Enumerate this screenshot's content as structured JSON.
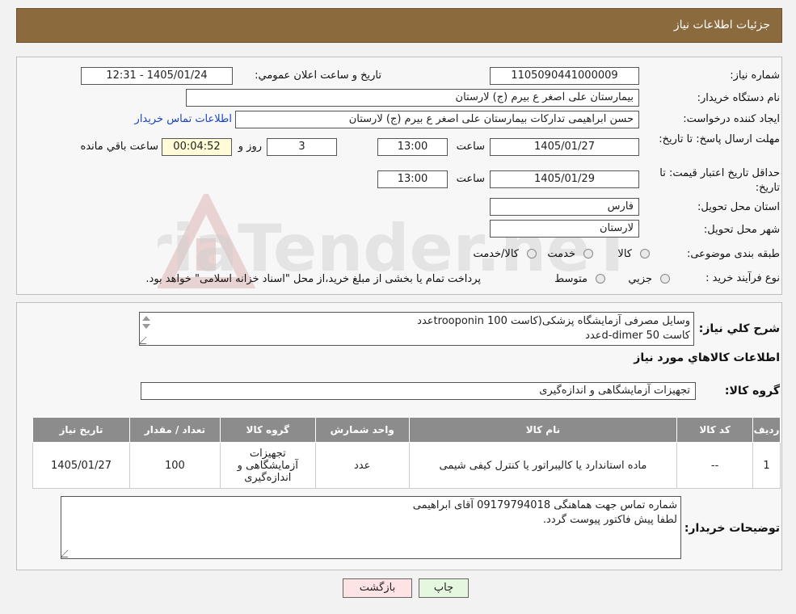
{
  "header": {
    "title": "جزئیات اطلاعات نیاز"
  },
  "need": {
    "number_label": "شماره نیاز:",
    "number_value": "1105090441000009",
    "announce_label": "تاریخ و ساعت اعلان عمومي:",
    "announce_value": "1405/01/24 - 12:31",
    "buyer_label": "نام دستگاه خریدار:",
    "buyer_value": "بیمارستان علی اصغر  ع  بیرم (ج) لارستان",
    "creator_label": "ایجاد کننده درخواست:",
    "creator_value": "حسن ابراهیمی تدارکات بیمارستان علی اصغر  ع  بیرم (ج) لارستان",
    "contact_link": "اطلاعات تماس خریدار",
    "deadline_label": "مهلت ارسال پاسخ: تا تاریخ:",
    "deadline_date": "1405/01/27",
    "time_label": "ساعت",
    "deadline_time": "13:00",
    "days_value": "3",
    "days_label": "روز و",
    "remaining_value": "00:04:52",
    "remaining_label": "ساعت باقي مانده",
    "validity_label": "حداقل تاریخ اعتبار قیمت: تا تاریخ:",
    "validity_date": "1405/01/29",
    "validity_time": "13:00",
    "province_label": "استان محل تحویل:",
    "province_value": "فارس",
    "city_label": "شهر محل تحویل:",
    "city_value": "لارستان",
    "category_label": "طبقه بندی موضوعی:",
    "category_options": [
      "کالا",
      "خدمت",
      "کالا/خدمت"
    ],
    "process_label": "نوع فرآیند خرید :",
    "process_options": [
      "جزيي",
      "متوسط"
    ],
    "process_note": "پرداخت تمام یا بخشی از مبلغ خرید،از محل \"اسناد خزانه اسلامی\" خواهد بود."
  },
  "summary": {
    "label": "شرح کلي نياز:",
    "line1": "وسایل مصرفی آزمایشگاه پزشکی(کاست trooponin 100عدد",
    "line2": "کاست d-dimer 50عدد"
  },
  "goods": {
    "section_title": "اطلاعات کالاهاي مورد نياز",
    "group_label": "گروه کالا:",
    "group_value": "تجهیزات آزمایشگاهی و اندازه‌گیری",
    "columns": [
      "رديف",
      "کد کالا",
      "نام کالا",
      "واحد شمارش",
      "گروه کالا",
      "تعداد / مقدار",
      "تاریخ نیاز"
    ],
    "rows": [
      [
        "1",
        "--",
        "ماده استاندارد یا کالیبراتور یا کنترل کیفی شیمی",
        "عدد",
        "تجهیزات آزمایشگاهی و اندازه‌گیری",
        "100",
        "1405/01/27"
      ]
    ]
  },
  "buyer_notes": {
    "label": "توضیحات خریدار:",
    "line1": "شماره تماس جهت هماهنگی 09179794018 آقای ابراهیمی",
    "line2": "لطفا پیش فاکتور پیوست گردد."
  },
  "buttons": {
    "print": "چاپ",
    "back": "بازگشت"
  },
  "watermark": "AriaTender.neT",
  "colors": {
    "header": "#8b6a3e",
    "print_btn": "#e6f7e0",
    "back_btn": "#fde3e3",
    "link": "#1a44c2"
  }
}
